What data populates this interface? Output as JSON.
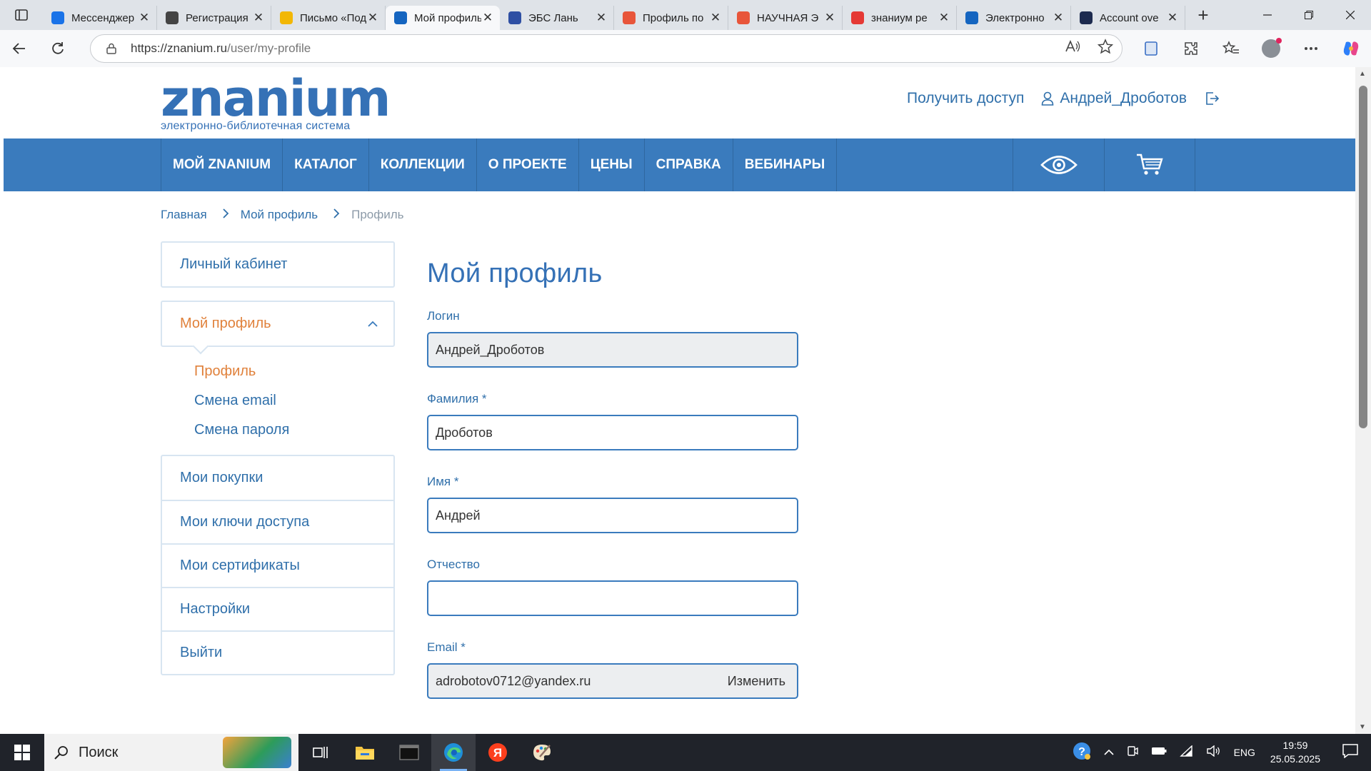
{
  "browser": {
    "tabs": [
      {
        "title": "Мессенджер",
        "favicon_color": "#1a73e8",
        "active": false
      },
      {
        "title": "Регистрация",
        "favicon_color": "#444444",
        "active": false
      },
      {
        "title": "Письмо «Под",
        "favicon_color": "#f2b705",
        "active": false
      },
      {
        "title": "Мой профиль",
        "favicon_color": "#1565c0",
        "active": true
      },
      {
        "title": "ЭБС Лань",
        "favicon_color": "#2e4fa3",
        "active": false
      },
      {
        "title": "Профиль по",
        "favicon_color": "#e8553a",
        "active": false
      },
      {
        "title": "НАУЧНАЯ Э",
        "favicon_color": "#e8553a",
        "active": false
      },
      {
        "title": "знаниум ре",
        "favicon_color": "#e53935",
        "active": false
      },
      {
        "title": "Электронно",
        "favicon_color": "#1565c0",
        "active": false
      },
      {
        "title": "Account ove",
        "favicon_color": "#1d2b4f",
        "active": false
      }
    ],
    "tab_close": "✕",
    "new_tab": "+",
    "url_host": "https://znanium.ru",
    "url_path": "/user/my-profile"
  },
  "site": {
    "logo_word": "znanium",
    "logo_tagline": "электронно-библиотечная система",
    "get_access": "Получить доступ",
    "username": "Андрей_Дроботов",
    "nav": [
      "МОЙ ZNANIUM",
      "КАТАЛОГ",
      "КОЛЛЕКЦИИ",
      "О ПРОЕКТЕ",
      "ЦЕНЫ",
      "СПРАВКА",
      "ВЕБИНАРЫ"
    ],
    "accent": "#3a7bbd",
    "highlight": "#e0813b"
  },
  "breadcrumb": {
    "home": "Главная",
    "section": "Мой профиль",
    "current": "Профиль"
  },
  "sidebar": {
    "cabinet": "Личный кабинет",
    "profile_group": "Мой профиль",
    "sub": [
      "Профиль",
      "Смена email",
      "Смена пароля"
    ],
    "items": [
      "Мои покупки",
      "Мои ключи доступа",
      "Мои сертификаты",
      "Настройки",
      "Выйти"
    ]
  },
  "form": {
    "title": "Мой профиль",
    "login_label": "Логин",
    "login_value": "Андрей_Дроботов",
    "lastname_label": "Фамилия *",
    "lastname_value": "Дроботов",
    "firstname_label": "Имя *",
    "firstname_value": "Андрей",
    "middlename_label": "Отчество",
    "middlename_value": "",
    "email_label": "Email *",
    "email_value": "adrobotov0712@yandex.ru",
    "email_change": "Изменить"
  },
  "taskbar": {
    "search_label": "Поиск",
    "lang": "ENG",
    "time": "19:59",
    "date": "25.05.2025"
  }
}
